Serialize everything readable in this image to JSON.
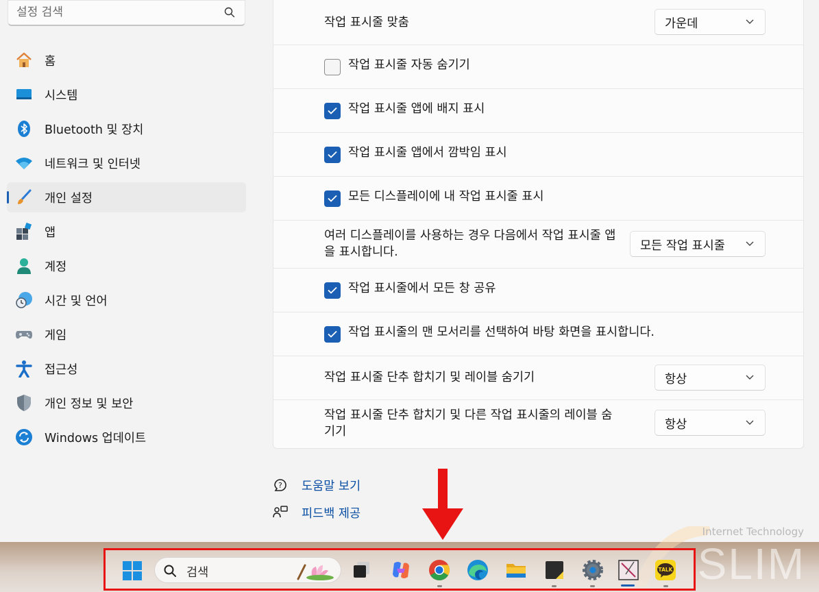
{
  "search": {
    "placeholder": "설정 검색"
  },
  "sidebar": {
    "items": [
      {
        "label": "홈",
        "icon": "home-icon"
      },
      {
        "label": "시스템",
        "icon": "system-icon"
      },
      {
        "label": "Bluetooth 및 장치",
        "icon": "bluetooth-icon"
      },
      {
        "label": "네트워크 및 인터넷",
        "icon": "wifi-icon"
      },
      {
        "label": "개인 설정",
        "icon": "brush-icon",
        "active": true
      },
      {
        "label": "앱",
        "icon": "apps-icon"
      },
      {
        "label": "계정",
        "icon": "account-icon"
      },
      {
        "label": "시간 및 언어",
        "icon": "clock-globe-icon"
      },
      {
        "label": "게임",
        "icon": "gamepad-icon"
      },
      {
        "label": "접근성",
        "icon": "accessibility-icon"
      },
      {
        "label": "개인 정보 및 보안",
        "icon": "shield-icon"
      },
      {
        "label": "Windows 업데이트",
        "icon": "update-icon"
      }
    ]
  },
  "settings": {
    "alignment": {
      "label": "작업 표시줄 맞춤",
      "value": "가운데"
    },
    "auto_hide": {
      "label": "작업 표시줄 자동 숨기기",
      "checked": false
    },
    "badges": {
      "label": "작업 표시줄 앱에 배지 표시",
      "checked": true
    },
    "flashing": {
      "label": "작업 표시줄 앱에서 깜박임 표시",
      "checked": true
    },
    "all_displays": {
      "label": "모든 디스플레이에 내 작업 표시줄 표시",
      "checked": true
    },
    "multi_display": {
      "label": "여러 디스플레이를 사용하는 경우 다음에서 작업 표시줄 앱을 표시합니다.",
      "value": "모든 작업 표시줄"
    },
    "share_window": {
      "label": "작업 표시줄에서 모든 창 공유",
      "checked": true
    },
    "far_corner": {
      "label": "작업 표시줄의 맨 모서리를 선택하여 바탕 화면을 표시합니다.",
      "checked": true
    },
    "combine": {
      "label": "작업 표시줄 단추 합치기 및 레이블 숨기기",
      "value": "항상"
    },
    "combine_other": {
      "label": "작업 표시줄 단추 합치기 및 다른 작업 표시줄의 레이블 숨기기",
      "value": "항상"
    }
  },
  "help": {
    "get_help": "도움말 보기",
    "feedback": "피드백 제공"
  },
  "taskbar": {
    "search_text": "검색",
    "apps": [
      "start-icon",
      "task-view-icon",
      "copilot-icon",
      "chrome-icon",
      "edge-icon",
      "file-explorer-icon",
      "sticky-notes-icon",
      "settings-gear-icon",
      "snipping-tool-icon",
      "kakaotalk-icon"
    ],
    "kakao_label": "TALK"
  },
  "watermark": {
    "tagline": "Internet Technology",
    "brand": "SLIM"
  },
  "colors": {
    "accent": "#1a5fb4",
    "highlight": "#e81313"
  }
}
